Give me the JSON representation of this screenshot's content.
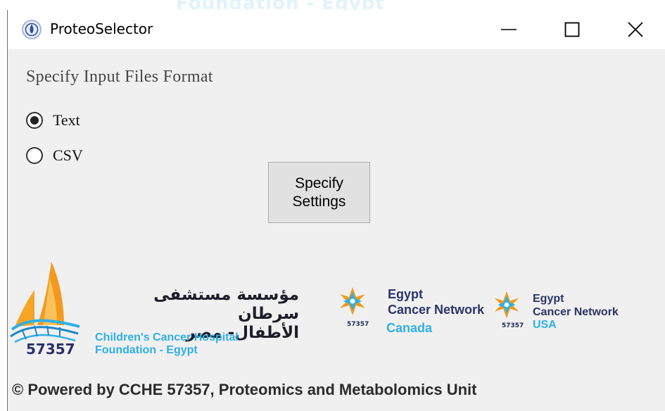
{
  "window": {
    "title": "ProteoSelector",
    "controls": {
      "minimize_icon": "minimize-icon",
      "maximize_icon": "maximize-icon",
      "close_icon": "close-icon"
    }
  },
  "form": {
    "section_label": "Specify Input Files Format",
    "options": [
      {
        "label": "Text",
        "selected": true
      },
      {
        "label": "CSV",
        "selected": false
      }
    ],
    "settings_button": "Specify Settings"
  },
  "logos": {
    "ccfh": {
      "number": "57357",
      "arabic_line1": "مؤسسة مستشفى سرطان",
      "arabic_line2": "الأطفال- مصر",
      "english_line1": "Children's Cancer Hospital",
      "english_line2": "Foundation - Egypt"
    },
    "ecn_canada": {
      "line1": "Egypt",
      "line2": "Cancer Network",
      "country": "Canada",
      "number": "57357"
    },
    "ecn_usa": {
      "line1": "Egypt",
      "line2": "Cancer Network",
      "country": "USA",
      "number": "57357"
    }
  },
  "footer": "© Powered by CCHE 57357, Proteomics and Metabolomics Unit",
  "colors": {
    "accent_blue": "#2eb0e4",
    "navy": "#2a3566",
    "orange": "#f39a1e",
    "button_face": "#e1e1e1",
    "window_bg": "#f0f0f0"
  }
}
